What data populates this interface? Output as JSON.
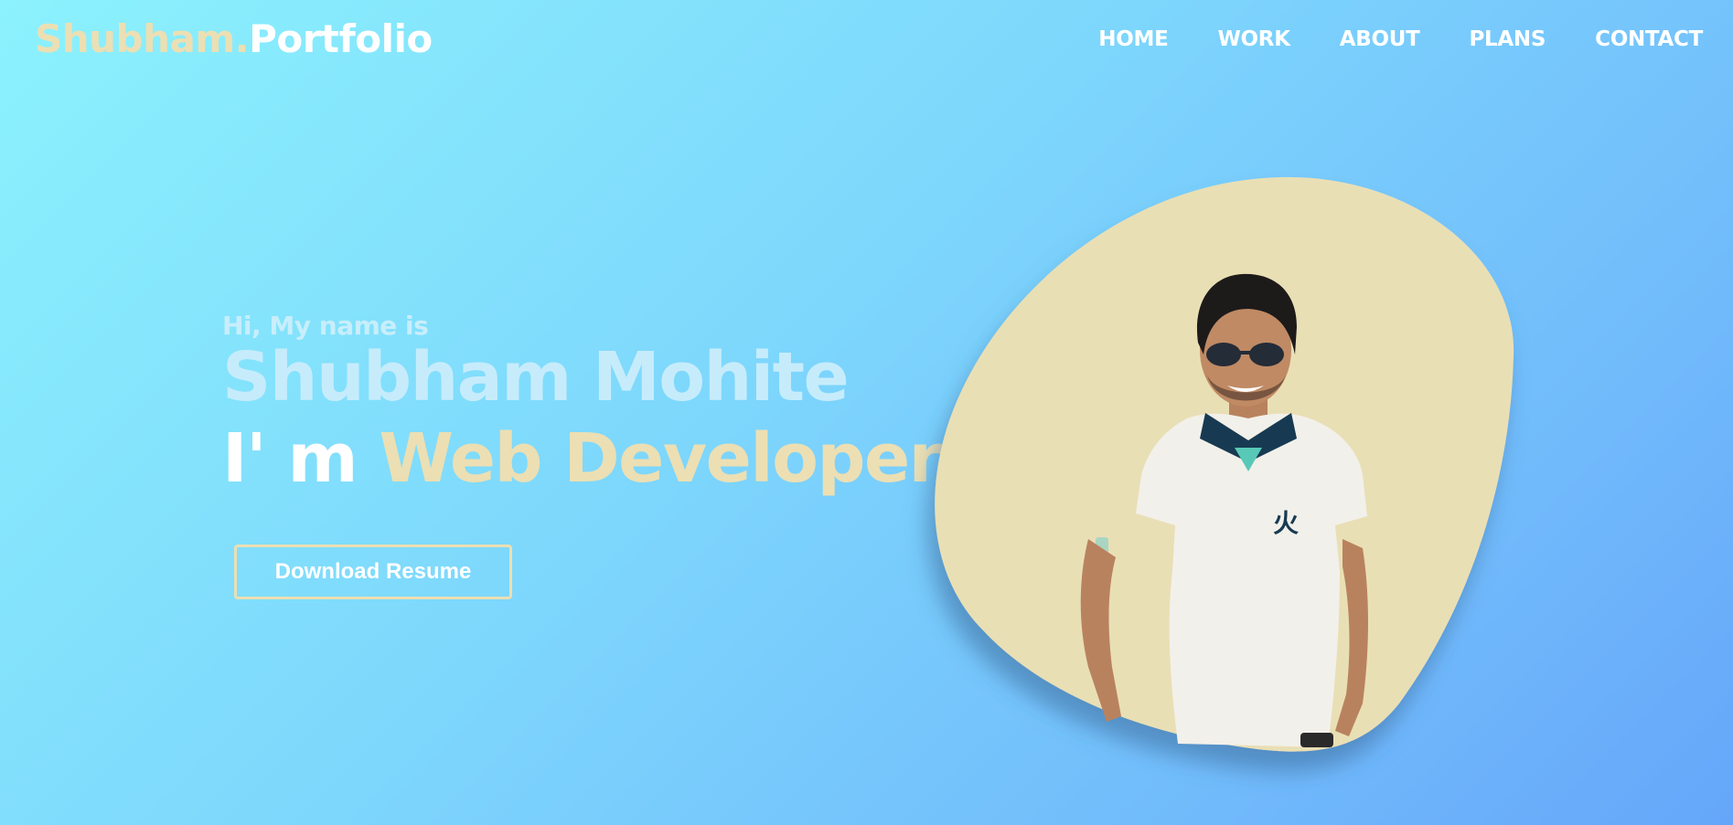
{
  "brand": {
    "first": "Shubham.",
    "second": "Portfolio"
  },
  "nav": {
    "items": [
      {
        "label": "HOME"
      },
      {
        "label": "WORK"
      },
      {
        "label": "ABOUT"
      },
      {
        "label": "PLANS"
      },
      {
        "label": "CONTACT"
      }
    ]
  },
  "hero": {
    "greeting": "Hi, My name is",
    "name": "Shubham Mohite",
    "role_prefix": "I' m",
    "role": "Web Developer",
    "button_label": "Download Resume"
  },
  "colors": {
    "accent": "#ecdfb3",
    "background_start": "#8cf2fd",
    "background_end": "#65a6fa",
    "blob_fill": "#e9dfb5"
  }
}
